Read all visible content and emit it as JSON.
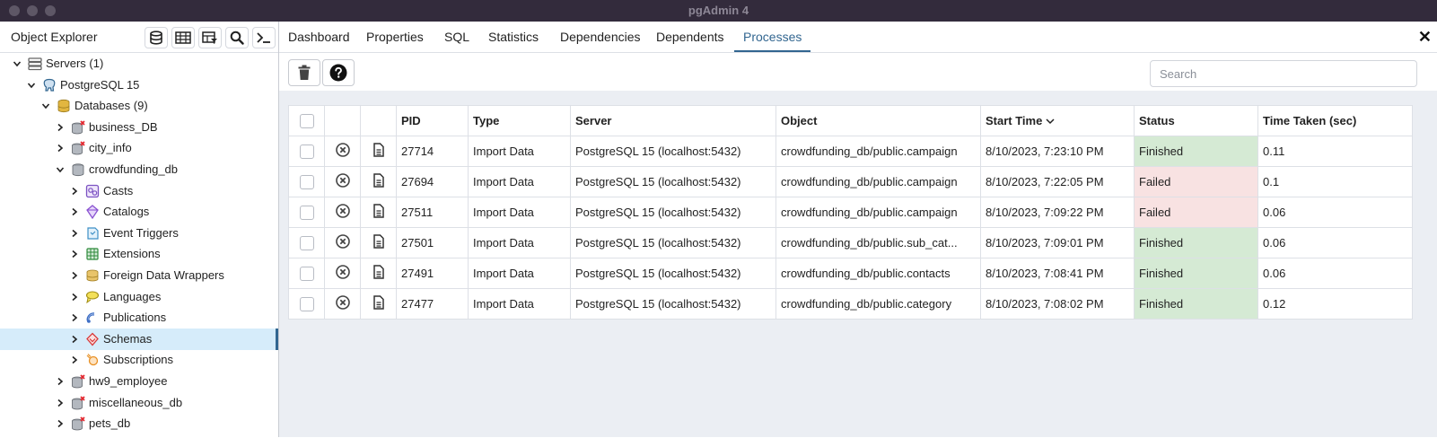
{
  "window": {
    "title": "pgAdmin 4"
  },
  "explorer": {
    "title": "Object Explorer",
    "tree": [
      {
        "label": "Servers (1)",
        "level": 0,
        "icon": "servers-icon",
        "expanded": true
      },
      {
        "label": "PostgreSQL 15",
        "level": 1,
        "icon": "postgres-elephant-icon",
        "expanded": true
      },
      {
        "label": "Databases (9)",
        "level": 2,
        "icon": "databases-icon",
        "expanded": true
      },
      {
        "label": "business_DB",
        "level": 3,
        "icon": "database-disconnected-icon",
        "expanded": false
      },
      {
        "label": "city_info",
        "level": 3,
        "icon": "database-disconnected-icon",
        "expanded": false
      },
      {
        "label": "crowdfunding_db",
        "level": 3,
        "icon": "database-icon",
        "expanded": true
      },
      {
        "label": "Casts",
        "level": 4,
        "icon": "casts-icon",
        "expanded": false
      },
      {
        "label": "Catalogs",
        "level": 4,
        "icon": "catalogs-icon",
        "expanded": false
      },
      {
        "label": "Event Triggers",
        "level": 4,
        "icon": "event-triggers-icon",
        "expanded": false
      },
      {
        "label": "Extensions",
        "level": 4,
        "icon": "extensions-icon",
        "expanded": false
      },
      {
        "label": "Foreign Data Wrappers",
        "level": 4,
        "icon": "foreign-data-wrappers-icon",
        "expanded": false
      },
      {
        "label": "Languages",
        "level": 4,
        "icon": "languages-icon",
        "expanded": false
      },
      {
        "label": "Publications",
        "level": 4,
        "icon": "publications-icon",
        "expanded": false
      },
      {
        "label": "Schemas",
        "level": 4,
        "icon": "schemas-icon",
        "expanded": false,
        "selected": true
      },
      {
        "label": "Subscriptions",
        "level": 4,
        "icon": "subscriptions-icon",
        "expanded": false
      },
      {
        "label": "hw9_employee",
        "level": 3,
        "icon": "database-disconnected-icon",
        "expanded": false
      },
      {
        "label": "miscellaneous_db",
        "level": 3,
        "icon": "database-disconnected-icon",
        "expanded": false
      },
      {
        "label": "pets_db",
        "level": 3,
        "icon": "database-disconnected-icon",
        "expanded": false
      }
    ]
  },
  "tabs": [
    "Dashboard",
    "Properties",
    "SQL",
    "Statistics",
    "Dependencies",
    "Dependents",
    "Processes"
  ],
  "active_tab": "Processes",
  "search": {
    "placeholder": "Search",
    "value": ""
  },
  "table": {
    "columns": [
      "PID",
      "Type",
      "Server",
      "Object",
      "Start Time",
      "Status",
      "Time Taken (sec)"
    ],
    "sort_column": "Start Time",
    "sort_direction": "descending",
    "rows": [
      {
        "pid": "27714",
        "type": "Import Data",
        "server": "PostgreSQL 15 (localhost:5432)",
        "object": "crowdfunding_db/public.campaign",
        "start": "8/10/2023, 7:23:10 PM",
        "status": "Finished",
        "time": "0.11"
      },
      {
        "pid": "27694",
        "type": "Import Data",
        "server": "PostgreSQL 15 (localhost:5432)",
        "object": "crowdfunding_db/public.campaign",
        "start": "8/10/2023, 7:22:05 PM",
        "status": "Failed",
        "time": "0.1"
      },
      {
        "pid": "27511",
        "type": "Import Data",
        "server": "PostgreSQL 15 (localhost:5432)",
        "object": "crowdfunding_db/public.campaign",
        "start": "8/10/2023, 7:09:22 PM",
        "status": "Failed",
        "time": "0.06"
      },
      {
        "pid": "27501",
        "type": "Import Data",
        "server": "PostgreSQL 15 (localhost:5432)",
        "object": "crowdfunding_db/public.sub_cat...",
        "start": "8/10/2023, 7:09:01 PM",
        "status": "Finished",
        "time": "0.06"
      },
      {
        "pid": "27491",
        "type": "Import Data",
        "server": "PostgreSQL 15 (localhost:5432)",
        "object": "crowdfunding_db/public.contacts",
        "start": "8/10/2023, 7:08:41 PM",
        "status": "Finished",
        "time": "0.06"
      },
      {
        "pid": "27477",
        "type": "Import Data",
        "server": "PostgreSQL 15 (localhost:5432)",
        "object": "crowdfunding_db/public.category",
        "start": "8/10/2023, 7:08:02 PM",
        "status": "Finished",
        "time": "0.12"
      }
    ]
  },
  "colors": {
    "accent": "#326690",
    "finished": "#d5ead4",
    "failed": "#f8e2e2",
    "titlebar": "#332b3c"
  }
}
